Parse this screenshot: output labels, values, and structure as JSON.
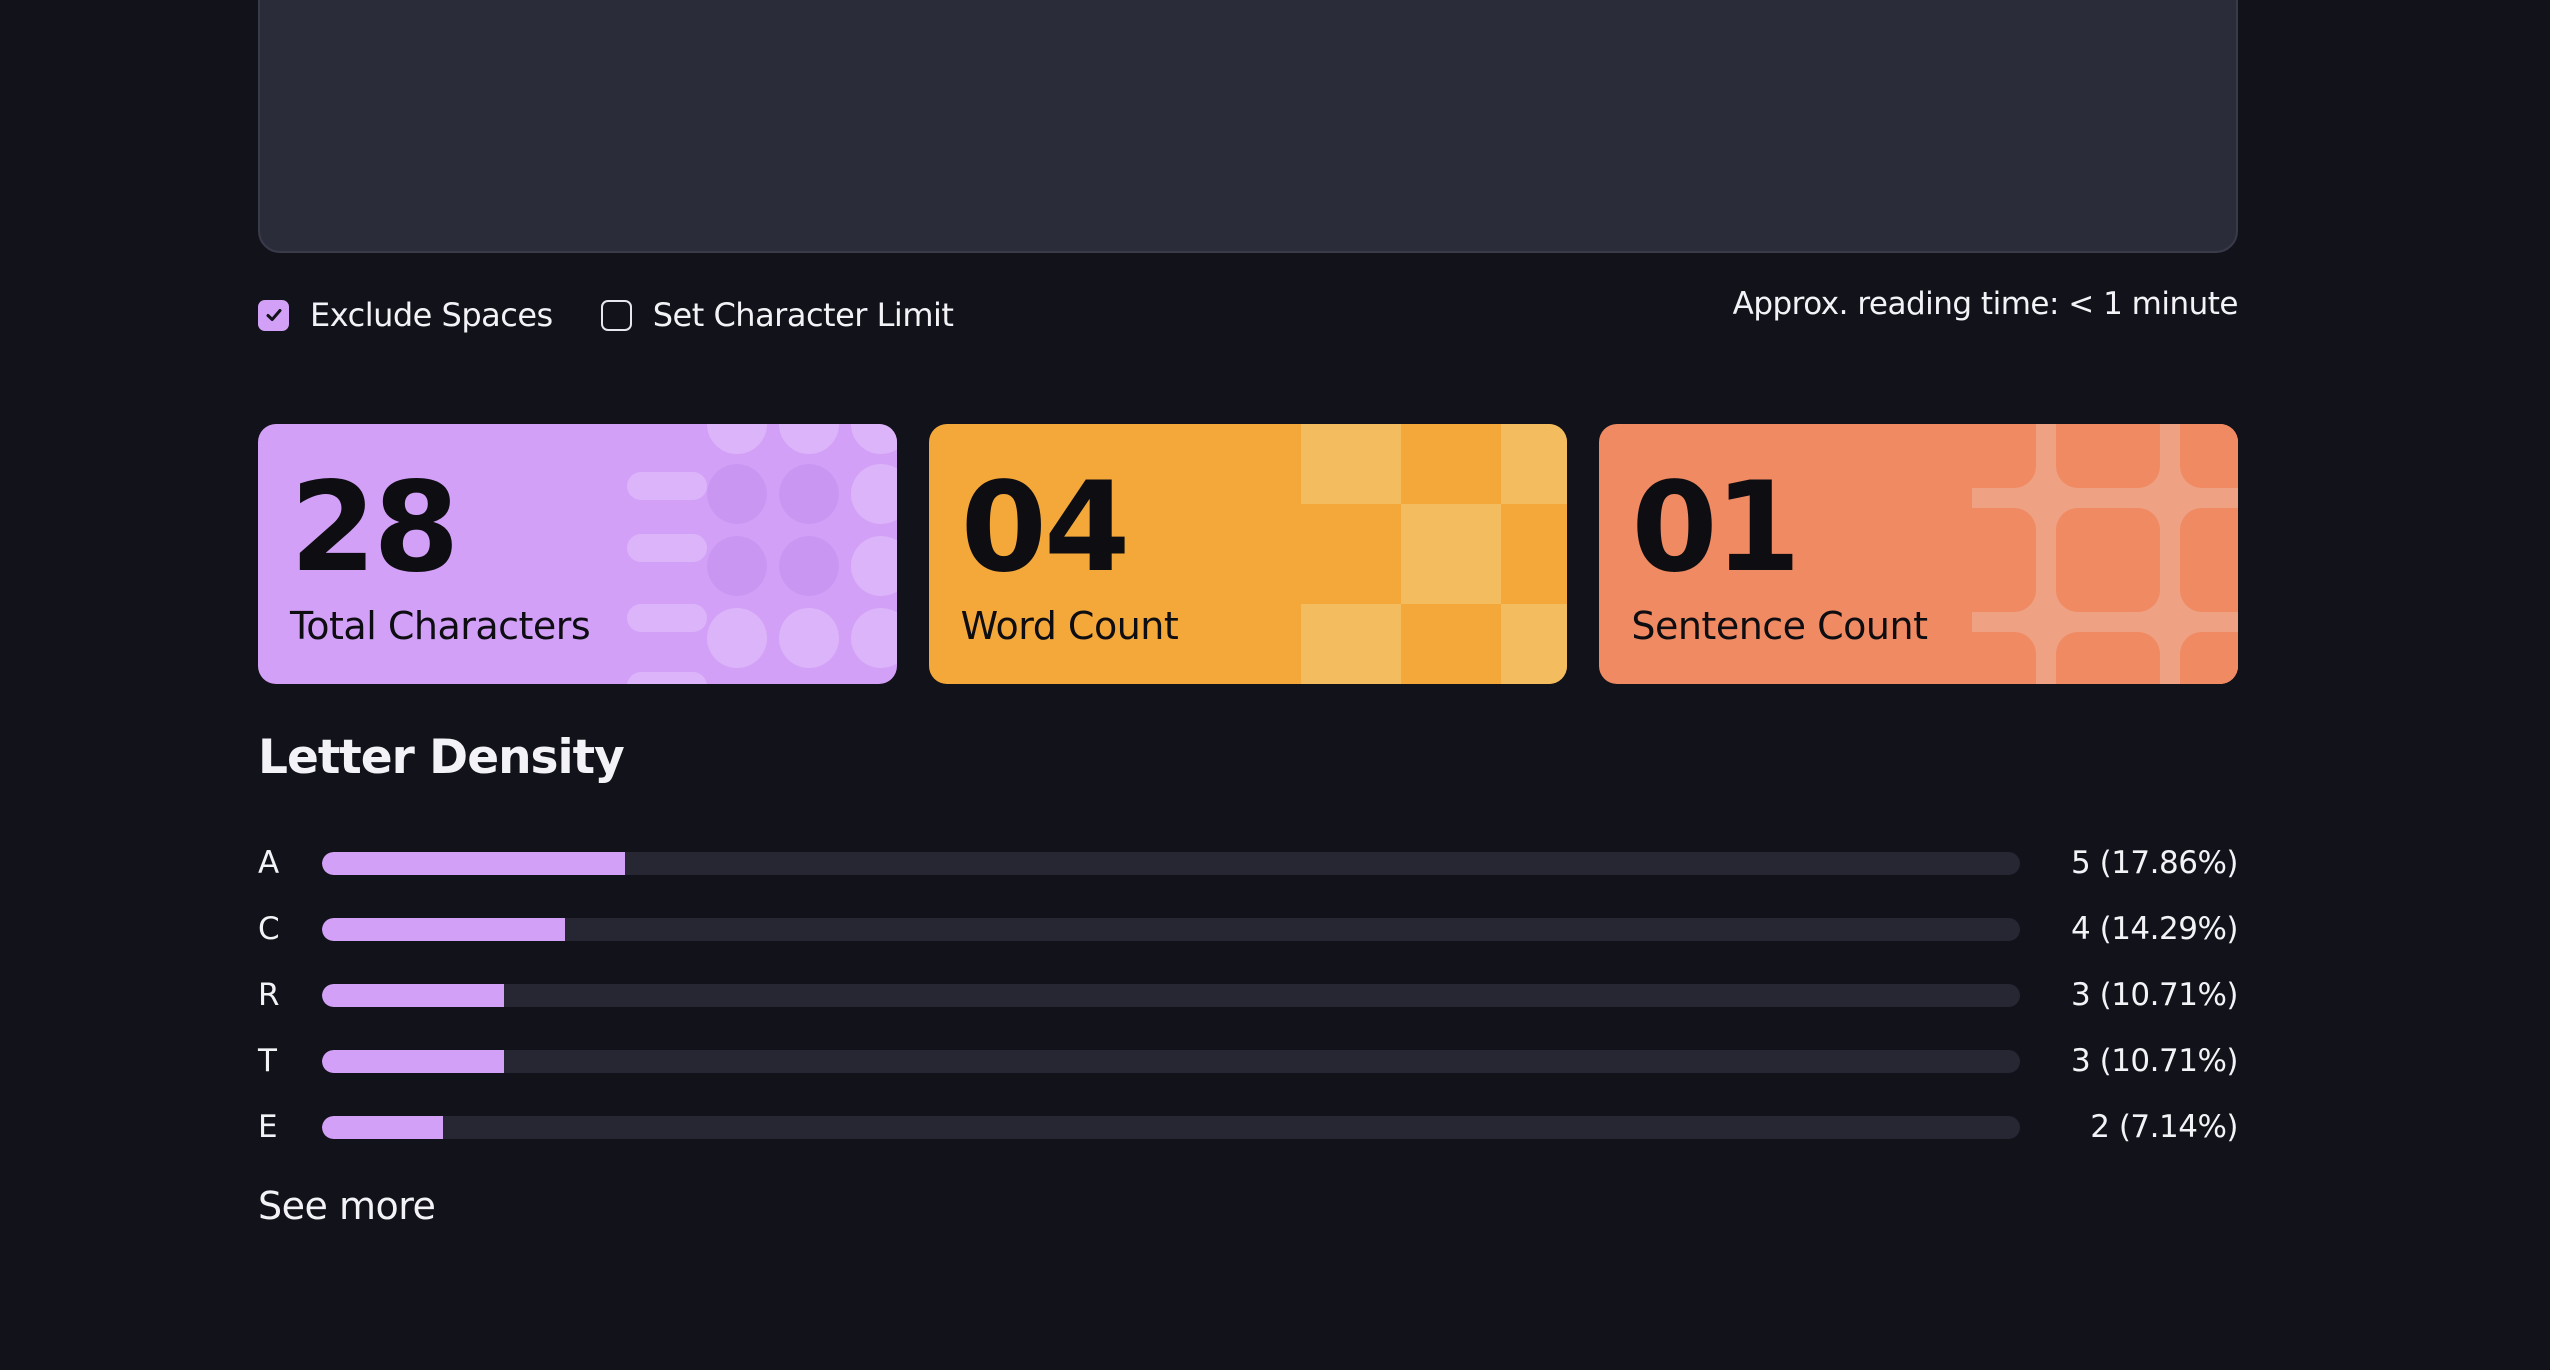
{
  "options": {
    "exclude_spaces": {
      "label": "Exclude Spaces",
      "checked": true
    },
    "char_limit": {
      "label": "Set Character Limit",
      "checked": false
    }
  },
  "reading_time": "Approx. reading time: < 1 minute",
  "cards": [
    {
      "value": "28",
      "label": "Total Characters",
      "color": "#d3a0f7"
    },
    {
      "value": "04",
      "label": "Word Count",
      "color": "#f5a83a"
    },
    {
      "value": "01",
      "label": "Sentence Count",
      "color": "#f08a62"
    }
  ],
  "density": {
    "title": "Letter Density",
    "rows": [
      {
        "letter": "A",
        "value": "5 (17.86%)",
        "fraction": 0.1786
      },
      {
        "letter": "C",
        "value": "4 (14.29%)",
        "fraction": 0.1429
      },
      {
        "letter": "R",
        "value": "3 (10.71%)",
        "fraction": 0.1071
      },
      {
        "letter": "T",
        "value": "3 (10.71%)",
        "fraction": 0.1071
      },
      {
        "letter": "E",
        "value": "2 (7.14%)",
        "fraction": 0.0714
      }
    ],
    "see_more": "See more"
  },
  "colors": {
    "background": "#12131a",
    "accent": "#d3a0f7",
    "track": "#262733"
  }
}
